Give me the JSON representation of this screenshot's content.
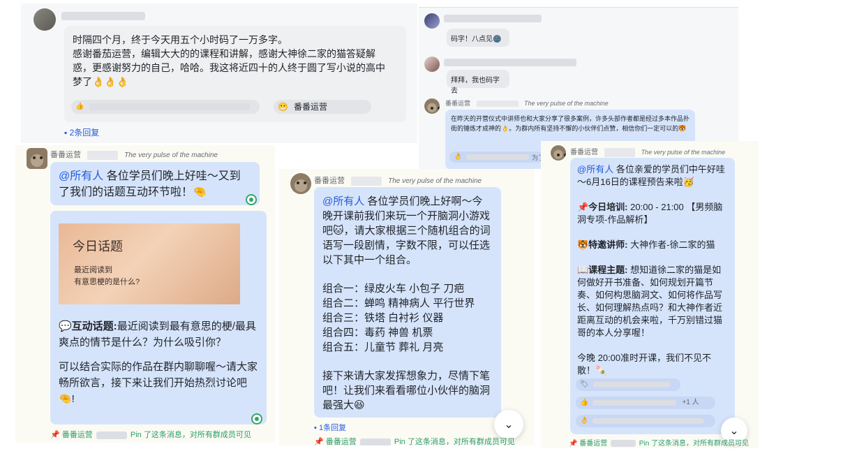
{
  "colors": {
    "bubble_blue": "#d6e4fb",
    "bubble_gray": "#eff0f1",
    "mention": "#245bdb",
    "pin_green": "#2b9c6a"
  },
  "panel_top_left": {
    "message": [
      "时隔四个月，终于今天用五个小时码了一万多字。",
      "感谢番茄运营，编辑大大的的课程和讲解，感谢大神徐二家的猫答疑解",
      "惑，更感谢努力的自己，哈哈。我这将近四十的人终于圆了写小说的高中",
      "梦了👌👌👌"
    ],
    "reaction_thumb": "👍",
    "reaction_name": "番番运营",
    "replies": "2条回复"
  },
  "panel_top_right": {
    "msg1": "码字！八点见🌚",
    "msg2": "拜拜，我也码字去",
    "sender": "番番运营",
    "slogan": "The very pulse of the machine",
    "msg3": "在昨天的开营仪式中讲师也和大家分享了很多案例，许多头部作者都是经过多本作品扑街的锤炼才成神的👌。为群内所有坚持不懈的小伙伴们点赞，相信你们一定可以的🐯",
    "reaction_count": "为了"
  },
  "panel_left": {
    "sender": "番番运营",
    "slogan": "The very pulse of the machine",
    "mention": "@所有人",
    "greeting": " 各位学员们晚上好哇～又到了我们的话题互动环节啦！🤏",
    "card_title": "今日话题",
    "card_line1": "最近阅读到",
    "card_line2": "有意思梗的是什么?",
    "topic_label": "💬互动话题:",
    "topic_text": "最近阅读到最有意思的梗/最具爽点的情节是什么？为什么吸引你？",
    "closing": "可以结合实际的作品在群内聊聊喔～请大家畅所欲言，接下来让我们开始热烈讨论吧🤏!",
    "pin_sender": "番番运营",
    "pin_text": "Pin 了这条消息，对所有群成员可见"
  },
  "panel_mid": {
    "sender": "番番运营",
    "slogan": "The very pulse of the machine",
    "mention": "@所有人",
    "intro": " 各位学员们晚上好啊～今晚开课前我们来玩一个开脑洞小游戏吧🐱，请大家根据三个随机组合的词语写一段剧情，字数不限，可以任选以下其中一个组合。",
    "combos": [
      "组合一：绿皮火车  小包子  刀疤",
      "组合二：蝉鸣  精神病人  平行世界",
      "组合三：铁塔  白衬衫  仪器",
      "组合四：毒药  神兽  机票",
      "组合五：儿童节  葬礼  月亮"
    ],
    "outro": "接下来请大家发挥想象力，尽情下笔吧！让我们来看看哪位小伙伴的脑洞最强大😆",
    "replies": "1条回复",
    "pin_sender": "番番运营",
    "pin_text": "Pin 了这条消息，对所有群成员可见"
  },
  "panel_right": {
    "sender": "番番运营",
    "slogan": "The very pulse of the machine",
    "mention": "@所有人",
    "intro": " 各位亲爱的学员们中午好哇～6月16日的课程预告来啦🥳",
    "training_label": "📌今日培训:",
    "training_text": " 20:00 - 21:00 【男频脑洞专项-作品解析】",
    "teacher_label": "🐯特邀讲师:",
    "teacher_text": " 大神作者-徐二家的猫",
    "theme_label": "📖课程主题:",
    "theme_text": " 想知道徐二家的猫是如何做好开书准备、如何规划开篇节奏、如何构思脑洞文、如何将作品写长、如何理解热点吗？和大神作者近距离互动的机会来啦，千万别错过猫哥的本人分享喔！",
    "closing": "今晚 20:00准时开课，我们不见不散！🍡",
    "reaction_count": "+1 人",
    "pin_sender": "番番运营",
    "pin_text": "Pin 了这条消息，对所有群成员可见"
  }
}
